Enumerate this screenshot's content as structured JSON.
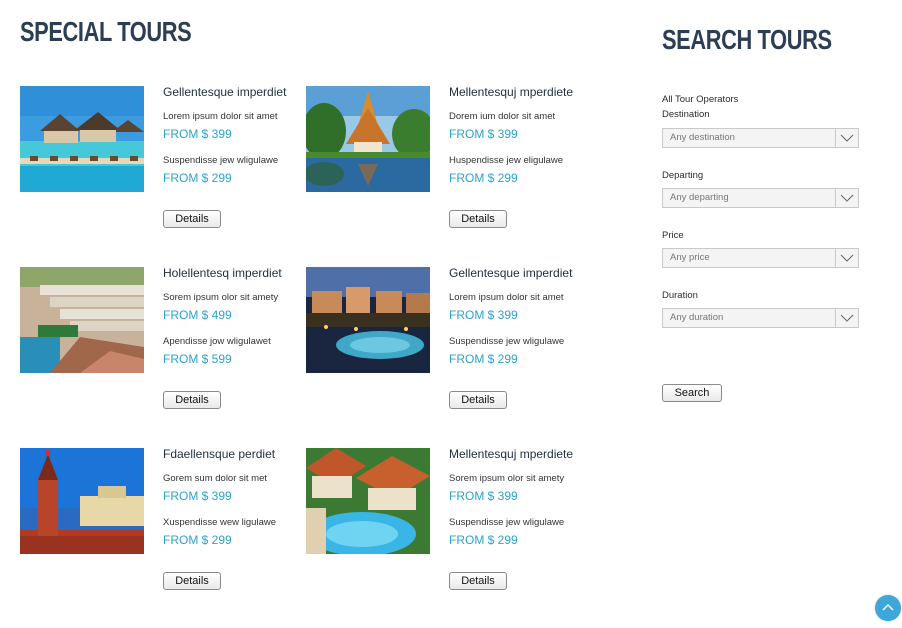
{
  "special": {
    "title": "SPECIAL TOURS",
    "details_label": "Details",
    "tours": [
      {
        "name": "Gellentesque imperdiet",
        "line1": "Lorem ipsum dolor sit amet",
        "price1": "FROM $ 399",
        "line2": "Suspendisse jew wligulawe",
        "price2": "FROM $ 299"
      },
      {
        "name": "Mellentesquj mperdiete",
        "line1": "Dorem ium dolor sit amet",
        "price1": "FROM $ 399",
        "line2": "Huspendisse jew eligulawe",
        "price2": "FROM $ 299"
      },
      {
        "name": "Holellentesq imperdiet",
        "line1": "Sorem ipsum olor sit amety",
        "price1": "FROM $ 499",
        "line2": "Apendisse jow wligulawet",
        "price2": "FROM $ 599"
      },
      {
        "name": "Gellentesque imperdiet",
        "line1": "Lorem ipsum dolor sit amet",
        "price1": "FROM $ 399",
        "line2": "Suspendisse jew wligulawe",
        "price2": "FROM $ 299"
      },
      {
        "name": "Fdaellensque perdiet",
        "line1": "Gorem sum dolor sit met",
        "price1": "FROM $ 399",
        "line2": "Xuspendisse wew ligulawe",
        "price2": "FROM $ 299"
      },
      {
        "name": "Mellentesquj mperdiete",
        "line1": "Sorem ipsum olor sit amety",
        "price1": "FROM $ 399",
        "line2": "Suspendisse jew wligulawe",
        "price2": "FROM $ 299"
      }
    ]
  },
  "search": {
    "title": "SEARCH TOURS",
    "operators_label": "All Tour Operators",
    "destination_label": "Destination",
    "destination_value": "Any destination",
    "departing_label": "Departing",
    "departing_value": "Any departing",
    "price_label": "Price",
    "price_value": "Any price",
    "duration_label": "Duration",
    "duration_value": "Any duration",
    "button_label": "Search"
  },
  "icons": {
    "dropdown": "chevron-down-icon",
    "scroll_top": "chevron-up-icon"
  },
  "colors": {
    "price": "#2aa3cf",
    "heading": "#2c3e55",
    "scroll_top": "#3ea7d9"
  }
}
